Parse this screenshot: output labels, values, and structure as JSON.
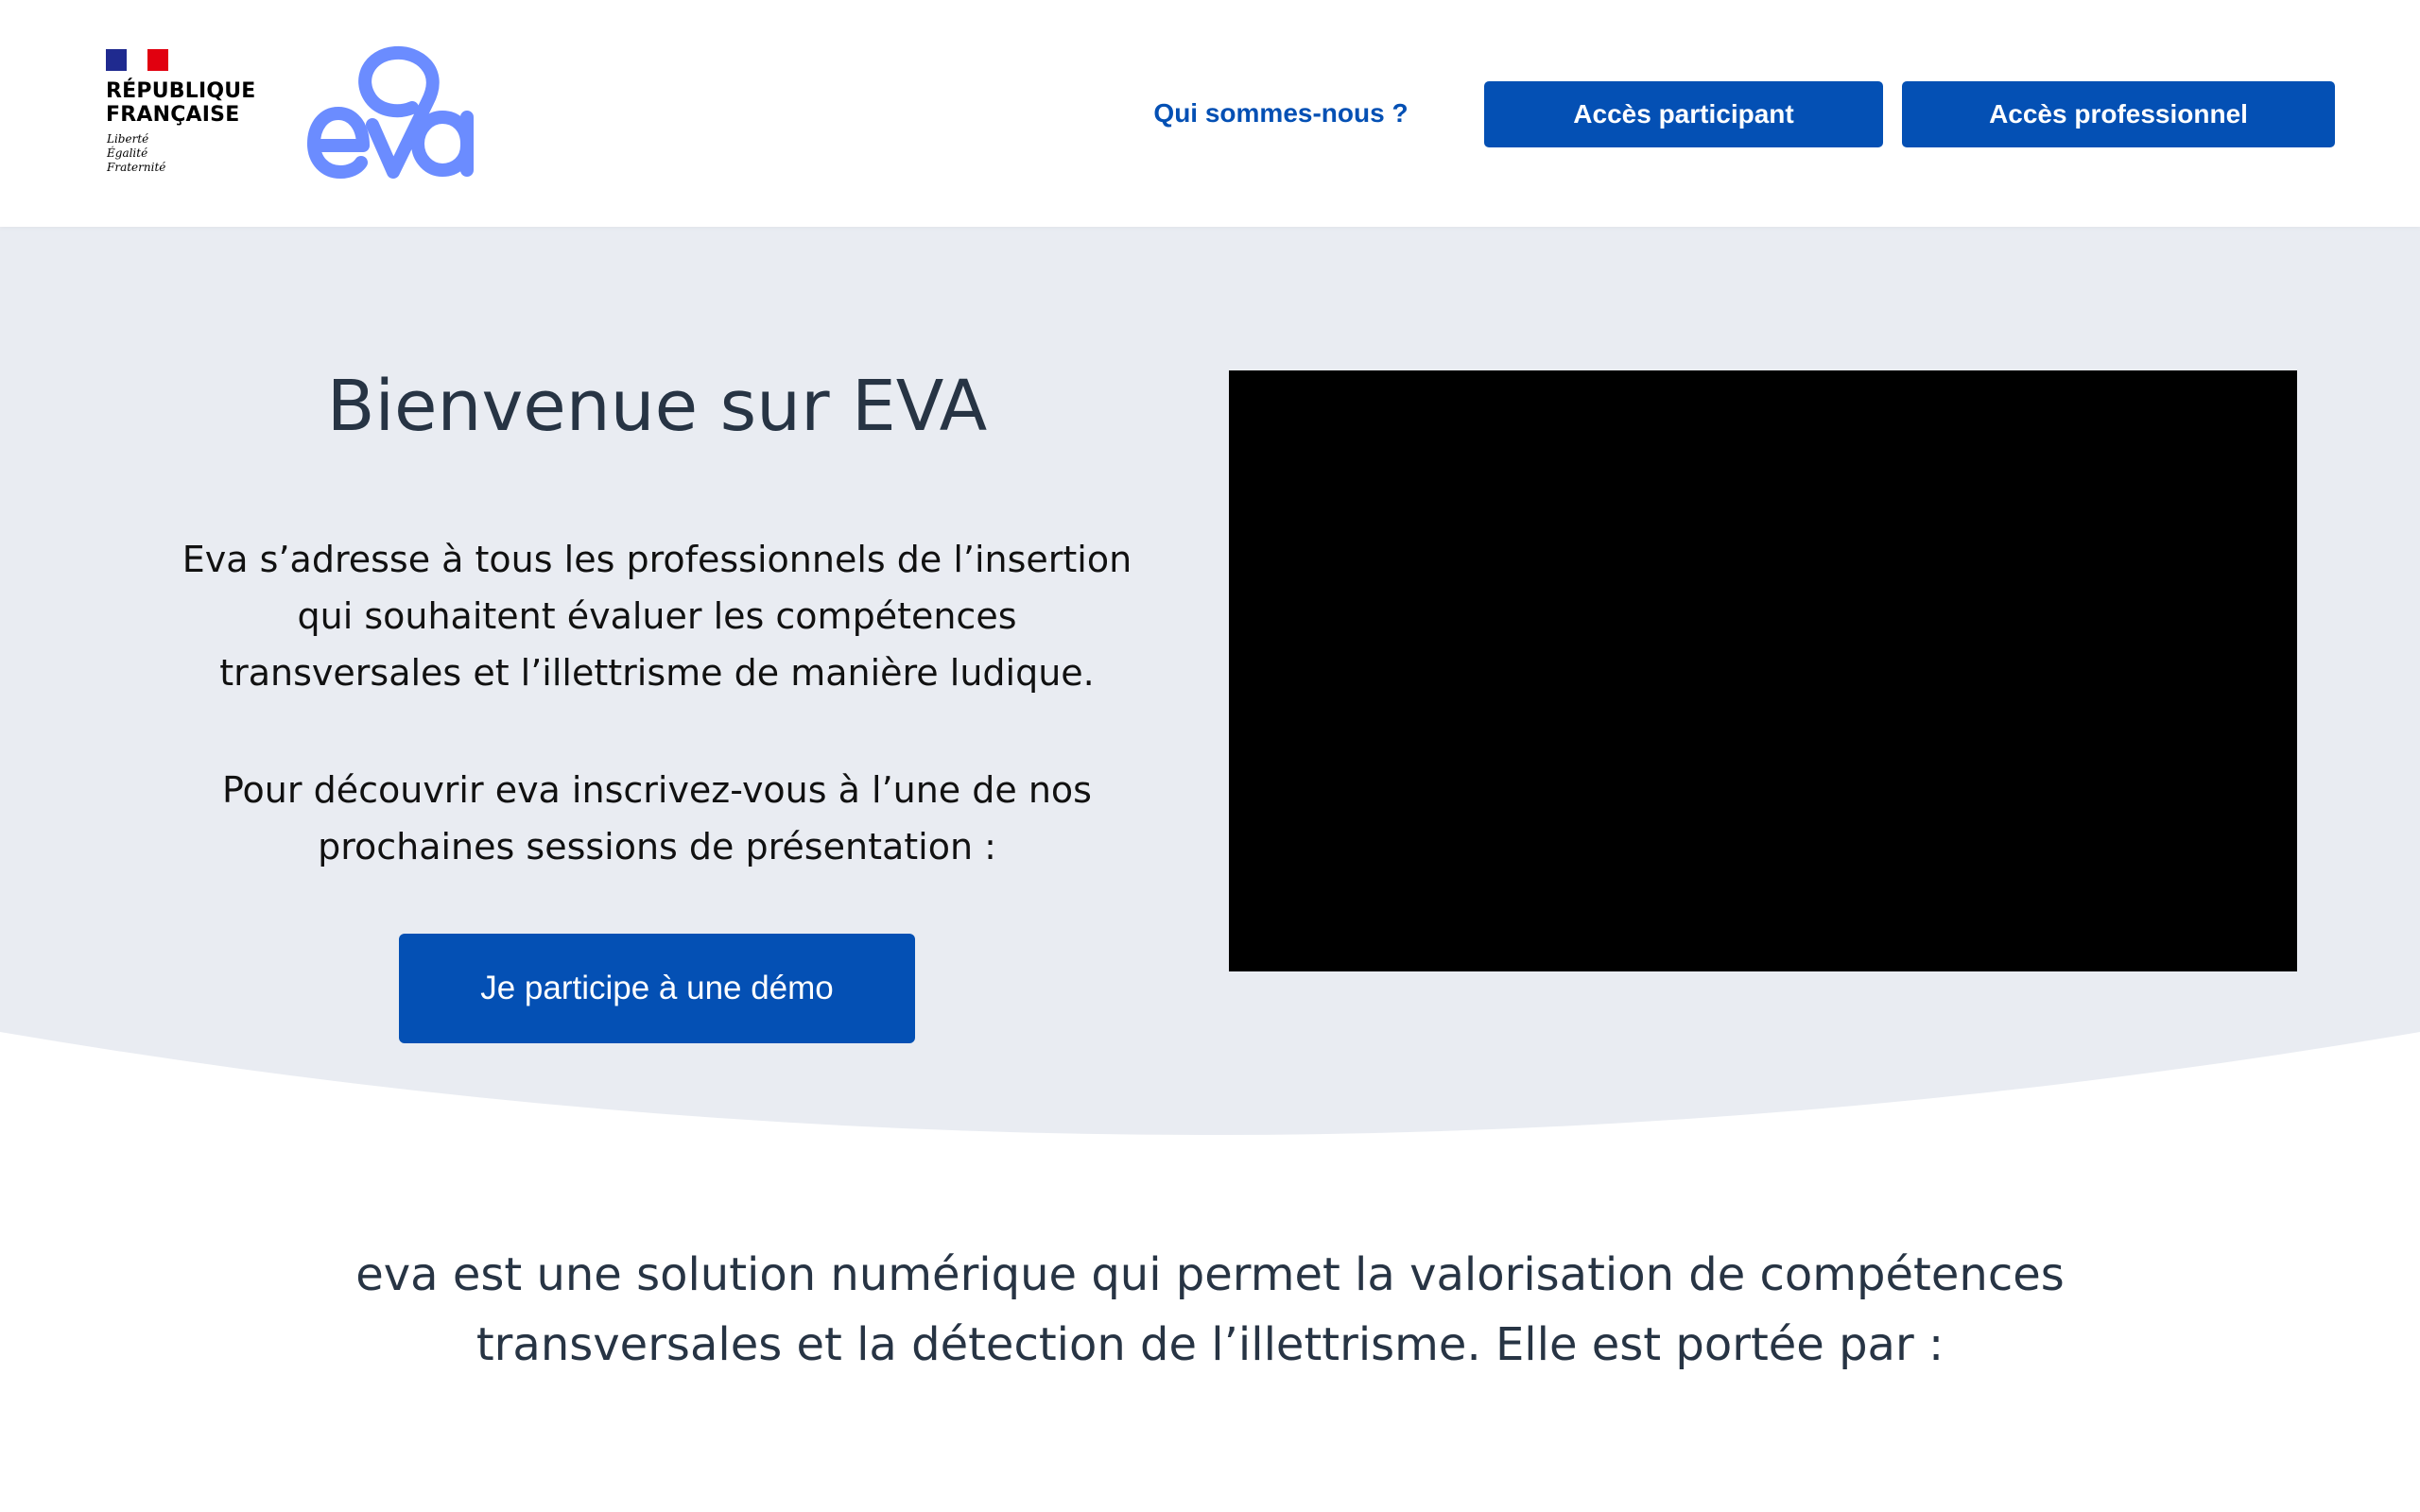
{
  "header": {
    "gov_logo": {
      "name_line1": "RÉPUBLIQUE",
      "name_line2": "FRANÇAISE",
      "motto_line1": "Liberté",
      "motto_line2": "Égalité",
      "motto_line3": "Fraternité"
    },
    "eva_logo_icon": "eva-logo",
    "nav": {
      "about_label": "Qui sommes-nous ?",
      "participant_label": "Accès participant",
      "professional_label": "Accès professionnel"
    }
  },
  "hero": {
    "title": "Bienvenue sur EVA",
    "paragraph1": "Eva s’adresse à tous les professionnels de l’insertion qui souhaitent évaluer les compétences transversales et l’illettrisme de manière ludique.",
    "paragraph2": "Pour découvrir eva inscrivez-vous à l’une de nos prochaines sessions de présentation :",
    "demo_button_label": "Je participe à une démo"
  },
  "about": {
    "text": "eva est une solution numérique qui permet la valorisation de compétences transversales et la détection de l’illettrisme. Elle est portée par :"
  },
  "colors": {
    "primary": "#0450b4",
    "hero_background": "#e9ecf2",
    "heading": "#273444",
    "eva_logo": "#6b8cff"
  }
}
